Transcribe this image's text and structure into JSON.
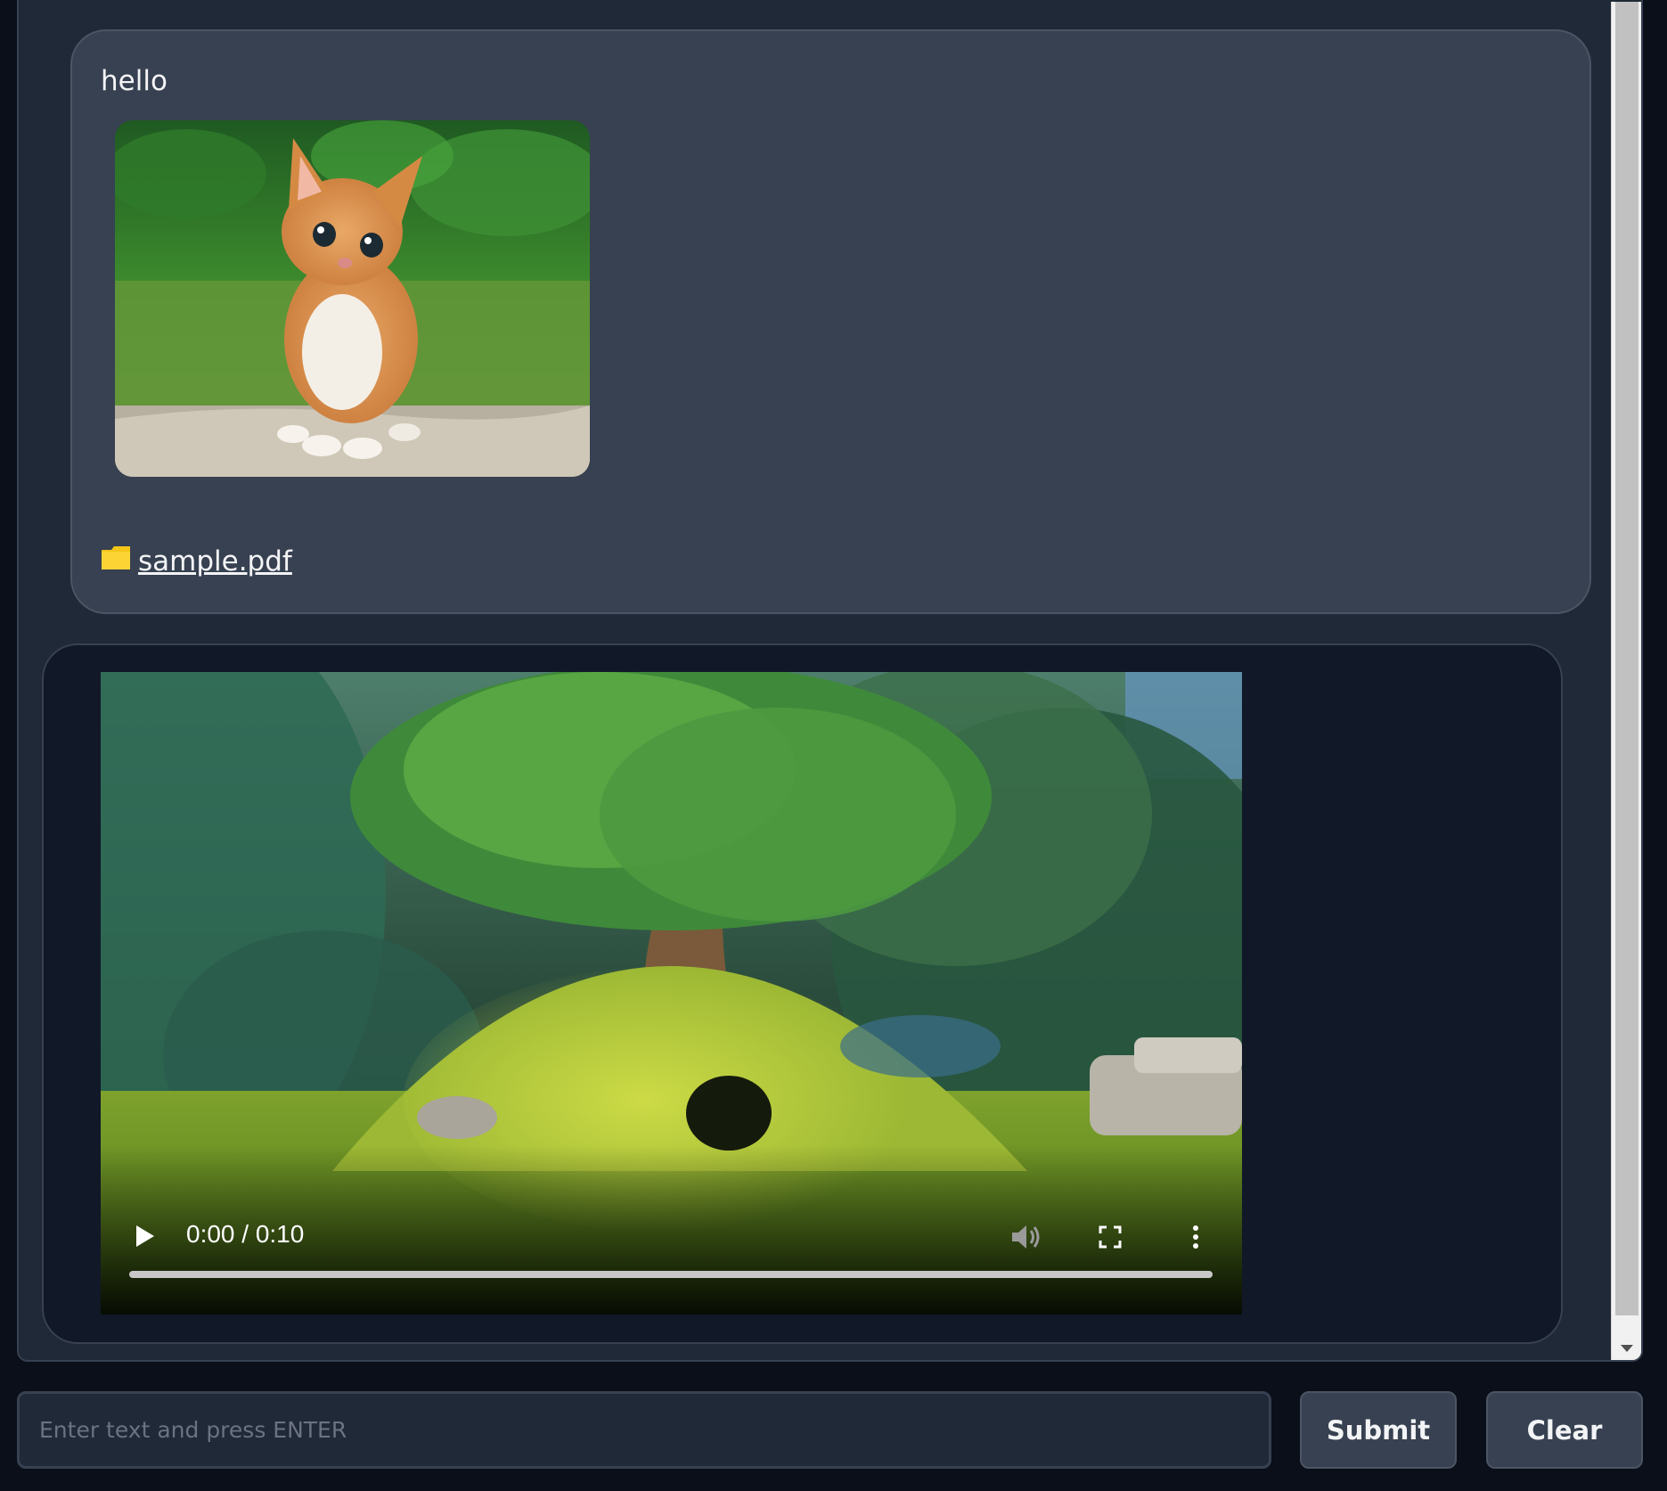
{
  "chat": {
    "messages": [
      {
        "role": "user",
        "text": "hello",
        "image": "kitten photo",
        "file_label": "sample.pdf",
        "file_icon": "folder-icon"
      },
      {
        "role": "bot",
        "video": {
          "time": "0:00 / 0:10",
          "progress": 0
        }
      }
    ]
  },
  "input": {
    "placeholder": "Enter text and press ENTER",
    "value": ""
  },
  "buttons": {
    "submit": "Submit",
    "clear": "Clear"
  },
  "colors": {
    "background": "#0b0f19",
    "panel": "#1f2937",
    "user_bubble": "#374151",
    "bot_bubble": "#111827",
    "folder": "#f5c518"
  }
}
